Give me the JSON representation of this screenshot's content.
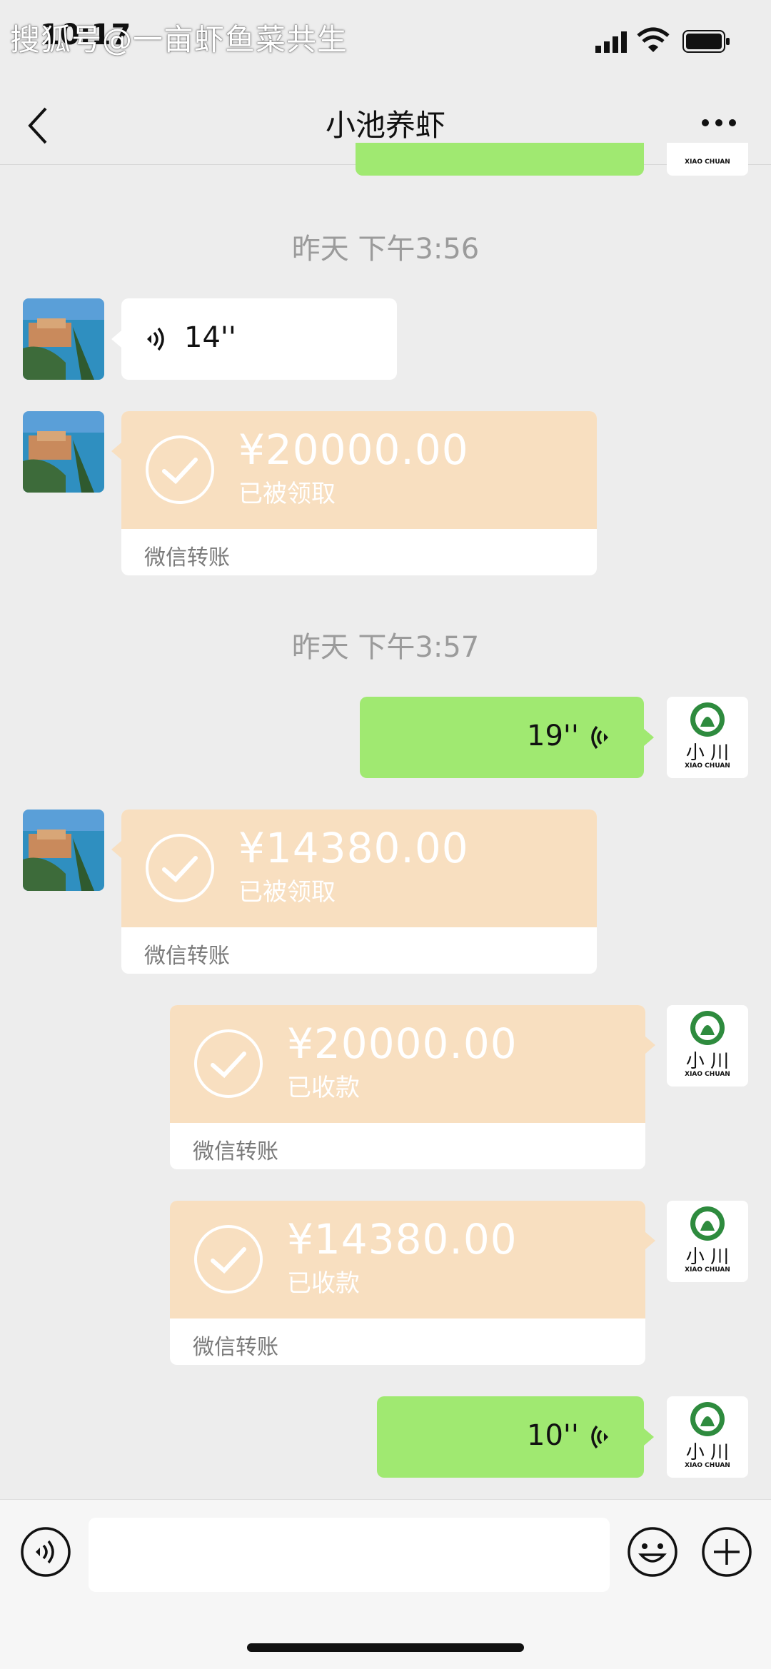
{
  "status_bar": {
    "time": "10:17",
    "watermark": "搜狐号@一亩虾鱼菜共生"
  },
  "nav": {
    "title": "小池养虾"
  },
  "messages": [
    {
      "type": "timestamp",
      "text": "昨天 下午3:56"
    },
    {
      "type": "voice",
      "side": "left",
      "duration": "14''"
    },
    {
      "type": "transfer",
      "side": "left",
      "amount": "¥20000.00",
      "status": "已被领取",
      "footer": "微信转账"
    },
    {
      "type": "timestamp",
      "text": "昨天 下午3:57"
    },
    {
      "type": "voice",
      "side": "right",
      "duration": "19''"
    },
    {
      "type": "transfer",
      "side": "left",
      "amount": "¥14380.00",
      "status": "已被领取",
      "footer": "微信转账"
    },
    {
      "type": "transfer",
      "side": "right",
      "amount": "¥20000.00",
      "status": "已收款",
      "footer": "微信转账"
    },
    {
      "type": "transfer",
      "side": "right",
      "amount": "¥14380.00",
      "status": "已收款",
      "footer": "微信转账"
    },
    {
      "type": "voice",
      "side": "right",
      "duration": "10''"
    }
  ],
  "my_avatar": {
    "logo_text_cn": "小 川",
    "logo_text_en": "XIAO CHUAN"
  },
  "colors": {
    "background": "#ededed",
    "bubble_green": "#a0e971",
    "transfer_orange": "#f8dfc0",
    "logo_green": "#2e8b3e"
  },
  "input_bar": {
    "placeholder": ""
  }
}
